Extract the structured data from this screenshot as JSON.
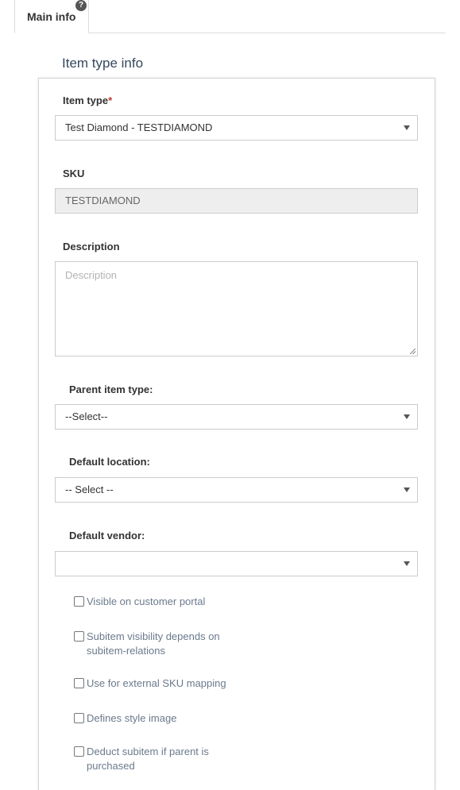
{
  "tabs": [
    {
      "label": "Main info",
      "active": true
    }
  ],
  "help_badge": "?",
  "section_title": "Item type info",
  "form": {
    "item_type": {
      "label": "Item type",
      "required_mark": "*",
      "value": "Test Diamond - TESTDIAMOND"
    },
    "sku": {
      "label": "SKU",
      "value": "TESTDIAMOND"
    },
    "description": {
      "label": "Description",
      "placeholder": "Description",
      "value": ""
    },
    "parent_item_type": {
      "label": "Parent item type:",
      "value": "--Select--"
    },
    "default_location": {
      "label": "Default location:",
      "value": "-- Select --"
    },
    "default_vendor": {
      "label": "Default vendor:",
      "value": ""
    },
    "checkboxes": [
      {
        "label": "Visible on customer portal",
        "checked": false
      },
      {
        "label": "Subitem visibility depends on subitem-relations",
        "checked": false
      },
      {
        "label": "Use for external SKU mapping",
        "checked": false
      },
      {
        "label": "Defines style image",
        "checked": false
      },
      {
        "label": "Deduct subitem if parent is purchased",
        "checked": false
      }
    ]
  },
  "colors": {
    "required": "#c0392b",
    "section_title": "#34495e",
    "checkbox_label": "#6b7a8c",
    "readonly_bg": "#eeeeee"
  }
}
